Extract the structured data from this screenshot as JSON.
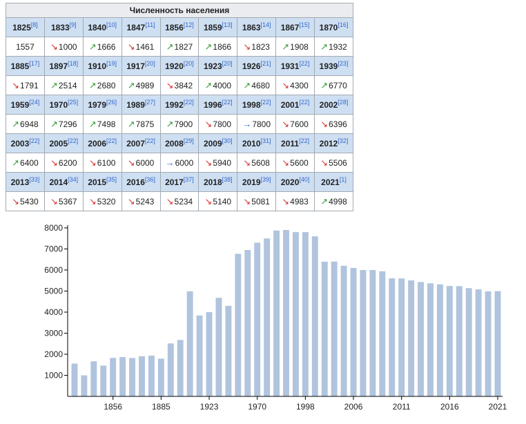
{
  "table": {
    "title": "Численность населения",
    "rows": [
      {
        "years": [
          [
            "1825",
            "[8]"
          ],
          [
            "1833",
            "[9]"
          ],
          [
            "1840",
            "[10]"
          ],
          [
            "1847",
            "[11]"
          ],
          [
            "1856",
            "[12]"
          ],
          [
            "1859",
            "[13]"
          ],
          [
            "1863",
            "[14]"
          ],
          [
            "1867",
            "[15]"
          ],
          [
            "1870",
            "[16]"
          ]
        ],
        "values": [
          [
            "",
            "1557"
          ],
          [
            "down",
            "1000"
          ],
          [
            "up",
            "1666"
          ],
          [
            "down",
            "1461"
          ],
          [
            "up",
            "1827"
          ],
          [
            "up",
            "1866"
          ],
          [
            "down",
            "1823"
          ],
          [
            "up",
            "1908"
          ],
          [
            "up",
            "1932"
          ]
        ]
      },
      {
        "years": [
          [
            "1885",
            "[17]"
          ],
          [
            "1897",
            "[18]"
          ],
          [
            "1910",
            "[19]"
          ],
          [
            "1917",
            "[20]"
          ],
          [
            "1920",
            "[20]"
          ],
          [
            "1923",
            "[20]"
          ],
          [
            "1926",
            "[21]"
          ],
          [
            "1931",
            "[22]"
          ],
          [
            "1939",
            "[23]"
          ]
        ],
        "values": [
          [
            "down",
            "1791"
          ],
          [
            "up",
            "2514"
          ],
          [
            "up",
            "2680"
          ],
          [
            "up",
            "4989"
          ],
          [
            "down",
            "3842"
          ],
          [
            "up",
            "4000"
          ],
          [
            "up",
            "4680"
          ],
          [
            "down",
            "4300"
          ],
          [
            "up",
            "6770"
          ]
        ]
      },
      {
        "years": [
          [
            "1959",
            "[24]"
          ],
          [
            "1970",
            "[25]"
          ],
          [
            "1979",
            "[26]"
          ],
          [
            "1989",
            "[27]"
          ],
          [
            "1992",
            "[22]"
          ],
          [
            "1996",
            "[22]"
          ],
          [
            "1998",
            "[22]"
          ],
          [
            "2001",
            "[22]"
          ],
          [
            "2002",
            "[28]"
          ]
        ],
        "values": [
          [
            "up",
            "6948"
          ],
          [
            "up",
            "7296"
          ],
          [
            "up",
            "7498"
          ],
          [
            "up",
            "7875"
          ],
          [
            "up",
            "7900"
          ],
          [
            "down",
            "7800"
          ],
          [
            "flat",
            "7800"
          ],
          [
            "down",
            "7600"
          ],
          [
            "down",
            "6396"
          ]
        ]
      },
      {
        "years": [
          [
            "2003",
            "[22]"
          ],
          [
            "2005",
            "[22]"
          ],
          [
            "2006",
            "[22]"
          ],
          [
            "2007",
            "[22]"
          ],
          [
            "2008",
            "[29]"
          ],
          [
            "2009",
            "[30]"
          ],
          [
            "2010",
            "[31]"
          ],
          [
            "2011",
            "[22]"
          ],
          [
            "2012",
            "[32]"
          ]
        ],
        "values": [
          [
            "up",
            "6400"
          ],
          [
            "down",
            "6200"
          ],
          [
            "down",
            "6100"
          ],
          [
            "down",
            "6000"
          ],
          [
            "flat",
            "6000"
          ],
          [
            "down",
            "5940"
          ],
          [
            "down",
            "5608"
          ],
          [
            "down",
            "5600"
          ],
          [
            "down",
            "5506"
          ]
        ]
      },
      {
        "years": [
          [
            "2013",
            "[33]"
          ],
          [
            "2014",
            "[34]"
          ],
          [
            "2015",
            "[35]"
          ],
          [
            "2016",
            "[36]"
          ],
          [
            "2017",
            "[37]"
          ],
          [
            "2018",
            "[38]"
          ],
          [
            "2019",
            "[39]"
          ],
          [
            "2020",
            "[40]"
          ],
          [
            "2021",
            "[1]"
          ]
        ],
        "values": [
          [
            "down",
            "5430"
          ],
          [
            "down",
            "5367"
          ],
          [
            "down",
            "5320"
          ],
          [
            "down",
            "5243"
          ],
          [
            "down",
            "5234"
          ],
          [
            "down",
            "5140"
          ],
          [
            "down",
            "5081"
          ],
          [
            "down",
            "4983"
          ],
          [
            "up",
            "4998"
          ]
        ]
      }
    ]
  },
  "trend_colors": {
    "up": "#3a9b3a",
    "down": "#d43030",
    "flat": "#3366cc"
  },
  "chart_data": {
    "type": "bar",
    "categories": [
      "1825",
      "1833",
      "1840",
      "1847",
      "1856",
      "1859",
      "1863",
      "1867",
      "1870",
      "1885",
      "1897",
      "1910",
      "1917",
      "1920",
      "1923",
      "1926",
      "1931",
      "1939",
      "1959",
      "1970",
      "1979",
      "1989",
      "1992",
      "1996",
      "1998",
      "2001",
      "2002",
      "2003",
      "2005",
      "2006",
      "2007",
      "2008",
      "2009",
      "2010",
      "2011",
      "2012",
      "2013",
      "2014",
      "2015",
      "2016",
      "2017",
      "2018",
      "2019",
      "2020",
      "2021"
    ],
    "values": [
      1557,
      1000,
      1666,
      1461,
      1827,
      1866,
      1823,
      1908,
      1932,
      1791,
      2514,
      2680,
      4989,
      3842,
      4000,
      4680,
      4300,
      6770,
      6948,
      7296,
      7498,
      7875,
      7900,
      7800,
      7800,
      7600,
      6396,
      6400,
      6200,
      6100,
      6000,
      6000,
      5940,
      5608,
      5600,
      5506,
      5430,
      5367,
      5320,
      5243,
      5234,
      5140,
      5081,
      4983,
      4998
    ],
    "x_tick_labels": [
      "1856",
      "1885",
      "1923",
      "1970",
      "1998",
      "2006",
      "2011",
      "2016",
      "2021"
    ],
    "y_ticks": [
      1000,
      2000,
      3000,
      4000,
      5000,
      6000,
      7000,
      8000
    ],
    "ylim": [
      0,
      8000
    ],
    "bar_color": "#b0c4de",
    "title": "",
    "xlabel": "",
    "ylabel": ""
  }
}
